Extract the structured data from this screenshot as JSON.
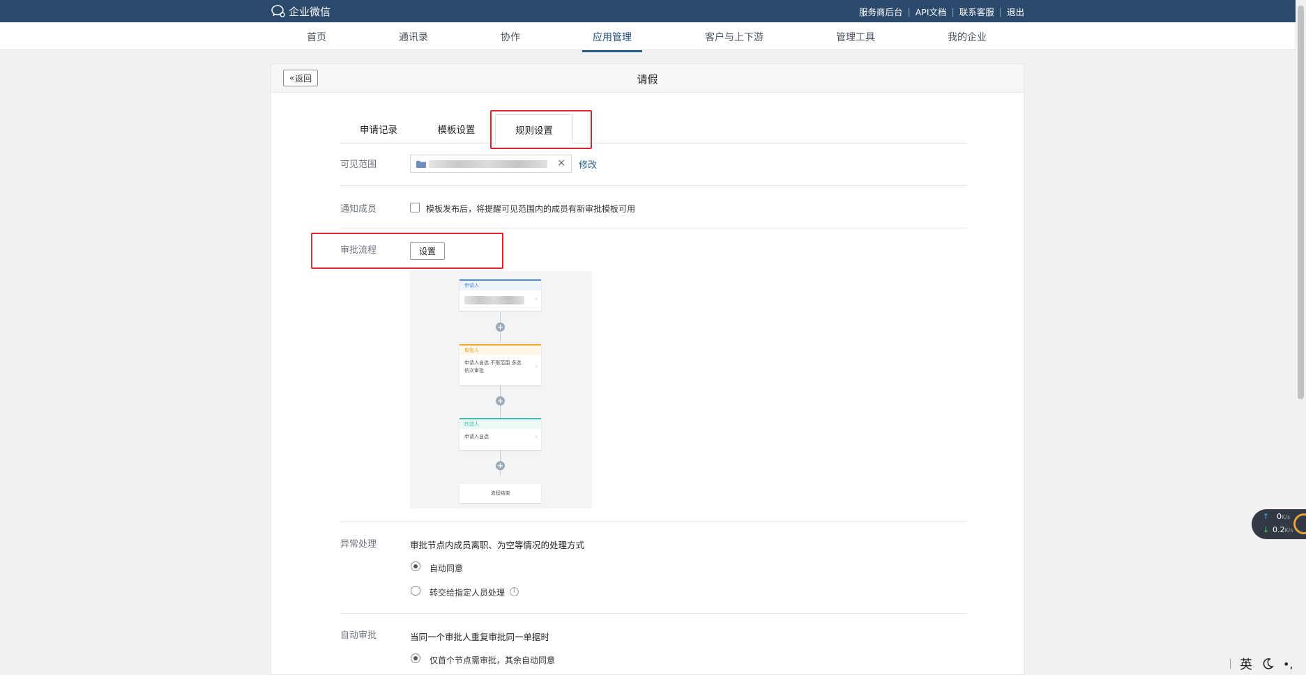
{
  "topbar": {
    "brand": "企业微信",
    "links": [
      "服务商后台",
      "API文档",
      "联系客服",
      "退出"
    ]
  },
  "nav": {
    "items": [
      "首页",
      "通讯录",
      "协作",
      "应用管理",
      "客户与上下游",
      "管理工具",
      "我的企业"
    ],
    "active": "应用管理"
  },
  "page": {
    "back_label": "返回",
    "title": "请假"
  },
  "tabs": [
    "申请记录",
    "模板设置",
    "规则设置"
  ],
  "active_tab": "规则设置",
  "scope": {
    "label": "可见范围",
    "edit_label": "修改"
  },
  "notify": {
    "label": "通知成员",
    "checkbox_text": "模板发布后，将提醒可见范围内的成员有新审批模板可用",
    "checked": false
  },
  "approval_flow": {
    "label": "审批流程",
    "set_button": "设置",
    "nodes": {
      "applicant_title": "申请人",
      "approver_title": "审批人",
      "approver_body": "申请人自选 不限范围 多选 依次审批",
      "cc_title": "抄送人",
      "cc_body": "申请人自选",
      "end": "流程结束"
    }
  },
  "exception": {
    "label": "异常处理",
    "description": "审批节点内成员离职、为空等情况的处理方式",
    "options": [
      "自动同意",
      "转交给指定人员处理"
    ],
    "selected": "自动同意"
  },
  "auto_approve": {
    "label": "自动审批",
    "description": "当同一个审批人重复审批同一单据时",
    "options": [
      "仅首个节点需审批，其余自动同意"
    ],
    "selected": "仅首个节点需审批，其余自动同意"
  },
  "net_widget": {
    "up_value": "0",
    "up_unit": "K/s",
    "down_value": "0.2",
    "down_unit": "K/s"
  },
  "ime": {
    "lang": "英"
  },
  "colors": {
    "topbar": "#2b4a6b",
    "highlight_box": "#e0232a",
    "link": "#2a5d8f"
  }
}
